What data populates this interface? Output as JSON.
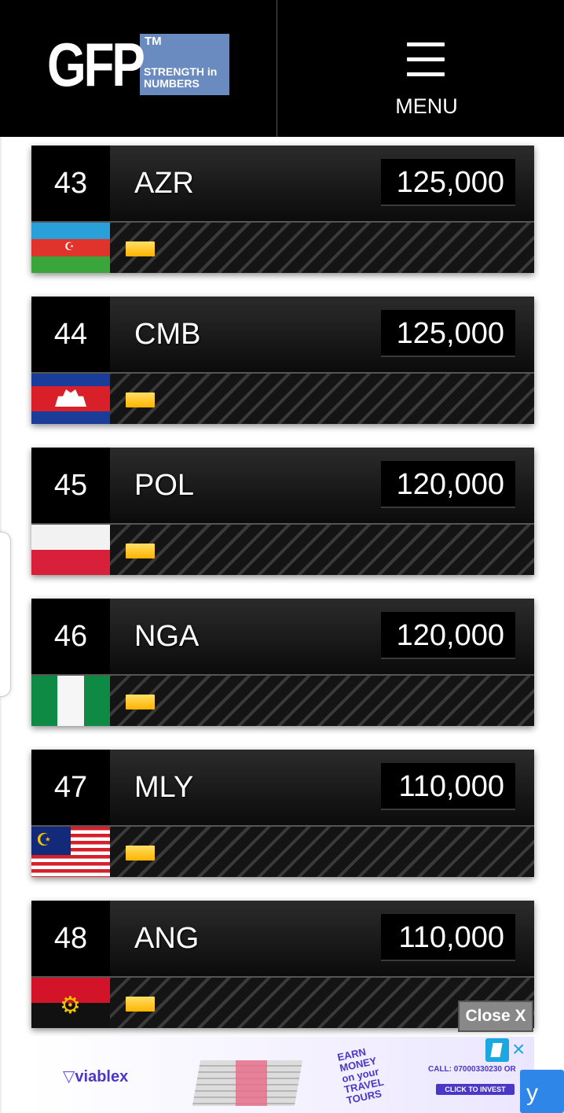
{
  "header": {
    "logo_letters": "GFP",
    "logo_tm": "TM",
    "logo_tagline_line1": "STRENGTH in",
    "logo_tagline_line2": "NUMBERS",
    "menu_label": "MENU"
  },
  "rankings": [
    {
      "rank": "43",
      "code": "AZR",
      "value": "125,000",
      "flag": "azerbaijan-flag"
    },
    {
      "rank": "44",
      "code": "CMB",
      "value": "125,000",
      "flag": "cambodia-flag"
    },
    {
      "rank": "45",
      "code": "POL",
      "value": "120,000",
      "flag": "poland-flag"
    },
    {
      "rank": "46",
      "code": "NGA",
      "value": "120,000",
      "flag": "nigeria-flag"
    },
    {
      "rank": "47",
      "code": "MLY",
      "value": "110,000",
      "flag": "malaysia-flag"
    },
    {
      "rank": "48",
      "code": "ANG",
      "value": "110,000",
      "flag": "angola-flag"
    }
  ],
  "ad": {
    "close_label": "Close X",
    "brand": "viablex",
    "headline_1": "EARN",
    "headline_2": "MONEY",
    "headline_3": "on your",
    "headline_4": "TRAVEL",
    "headline_5": "TOURS",
    "call_text": "CALL: 07000330230 OR",
    "cta_label": "CLICK TO INVEST",
    "close_icon": "×",
    "right_button_char": "y"
  },
  "colors": {
    "header_bg": "#000000",
    "bar_accent": "#ffb300",
    "ad_accent": "#4a37c8"
  }
}
